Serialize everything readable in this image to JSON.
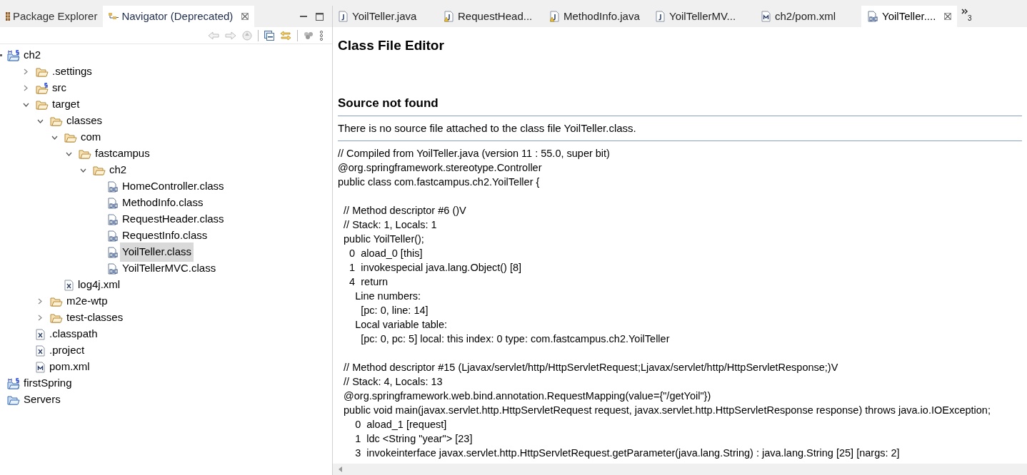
{
  "views": [
    {
      "label": "Package Explorer",
      "selected": false,
      "closable": false
    },
    {
      "label": "Navigator (Deprecated)",
      "selected": true,
      "closable": true
    }
  ],
  "tree": [
    {
      "label": "ch2",
      "kind": "project",
      "expanded": true,
      "children": [
        {
          "label": ".settings",
          "kind": "folder",
          "expanded": false
        },
        {
          "label": "src",
          "kind": "source-folder",
          "expanded": false
        },
        {
          "label": "target",
          "kind": "folder",
          "expanded": true,
          "children": [
            {
              "label": "classes",
              "kind": "folder",
              "expanded": true,
              "children": [
                {
                  "label": "com",
                  "kind": "folder",
                  "expanded": true,
                  "children": [
                    {
                      "label": "fastcampus",
                      "kind": "folder",
                      "expanded": true,
                      "children": [
                        {
                          "label": "ch2",
                          "kind": "folder",
                          "expanded": true,
                          "children": [
                            {
                              "label": "HomeController.class",
                              "kind": "class",
                              "selected": false
                            },
                            {
                              "label": "MethodInfo.class",
                              "kind": "class",
                              "selected": false
                            },
                            {
                              "label": "RequestHeader.class",
                              "kind": "class",
                              "selected": false
                            },
                            {
                              "label": "RequestInfo.class",
                              "kind": "class",
                              "selected": false
                            },
                            {
                              "label": "YoilTeller.class",
                              "kind": "class",
                              "selected": true
                            },
                            {
                              "label": "YoilTellerMVC.class",
                              "kind": "class",
                              "selected": false
                            }
                          ]
                        }
                      ]
                    }
                  ]
                },
                {
                  "label": "log4j.xml",
                  "kind": "xml"
                }
              ]
            },
            {
              "label": "m2e-wtp",
              "kind": "folder",
              "expanded": false
            },
            {
              "label": "test-classes",
              "kind": "folder",
              "expanded": false
            }
          ]
        },
        {
          "label": ".classpath",
          "kind": "xml"
        },
        {
          "label": ".project",
          "kind": "xml"
        },
        {
          "label": "pom.xml",
          "kind": "maven"
        }
      ]
    },
    {
      "label": "firstSpring",
      "kind": "project"
    },
    {
      "label": "Servers",
      "kind": "open-folder"
    }
  ],
  "editor_tabs": [
    {
      "label": "YoilTeller.java",
      "kind": "java",
      "selected": false
    },
    {
      "label": "RequestHead...",
      "kind": "java-warning",
      "selected": false
    },
    {
      "label": "MethodInfo.java",
      "kind": "java-warning",
      "selected": false
    },
    {
      "label": "YoilTellerMV...",
      "kind": "java",
      "selected": false
    },
    {
      "label": "ch2/pom.xml",
      "kind": "maven",
      "selected": false
    },
    {
      "label": "YoilTeller....",
      "kind": "class",
      "selected": true
    }
  ],
  "overflow_count": "3",
  "editor": {
    "title": "Class File Editor",
    "heading": "Source not found",
    "message": "There is no source file attached to the class file YoilTeller.class.",
    "code_blocks": [
      [
        "// Compiled from YoilTeller.java (version 11 : 55.0, super bit)",
        "@org.springframework.stereotype.Controller",
        "public class com.fastcampus.ch2.YoilTeller {"
      ],
      [
        "  // Method descriptor #6 ()V",
        "  // Stack: 1, Locals: 1",
        "  public YoilTeller();",
        "    0  aload_0 [this]",
        "    1  invokespecial java.lang.Object() [8]",
        "    4  return",
        "      Line numbers:",
        "        [pc: 0, line: 14]",
        "      Local variable table:",
        "        [pc: 0, pc: 5] local: this index: 0 type: com.fastcampus.ch2.YoilTeller"
      ],
      [
        "  // Method descriptor #15 (Ljavax/servlet/http/HttpServletRequest;Ljavax/servlet/http/HttpServletResponse;)V",
        "  // Stack: 4, Locals: 13",
        "  @org.springframework.web.bind.annotation.RequestMapping(value={\"/getYoil\"})",
        "  public void main(javax.servlet.http.HttpServletRequest request, javax.servlet.http.HttpServletResponse response) throws java.io.IOException;",
        "      0  aload_1 [request]",
        "      1  ldc <String \"year\"> [23]",
        "      3  invokeinterface javax.servlet.http.HttpServletRequest.getParameter(java.lang.String) : java.lang.String [25] [nargs: 2]"
      ]
    ]
  }
}
